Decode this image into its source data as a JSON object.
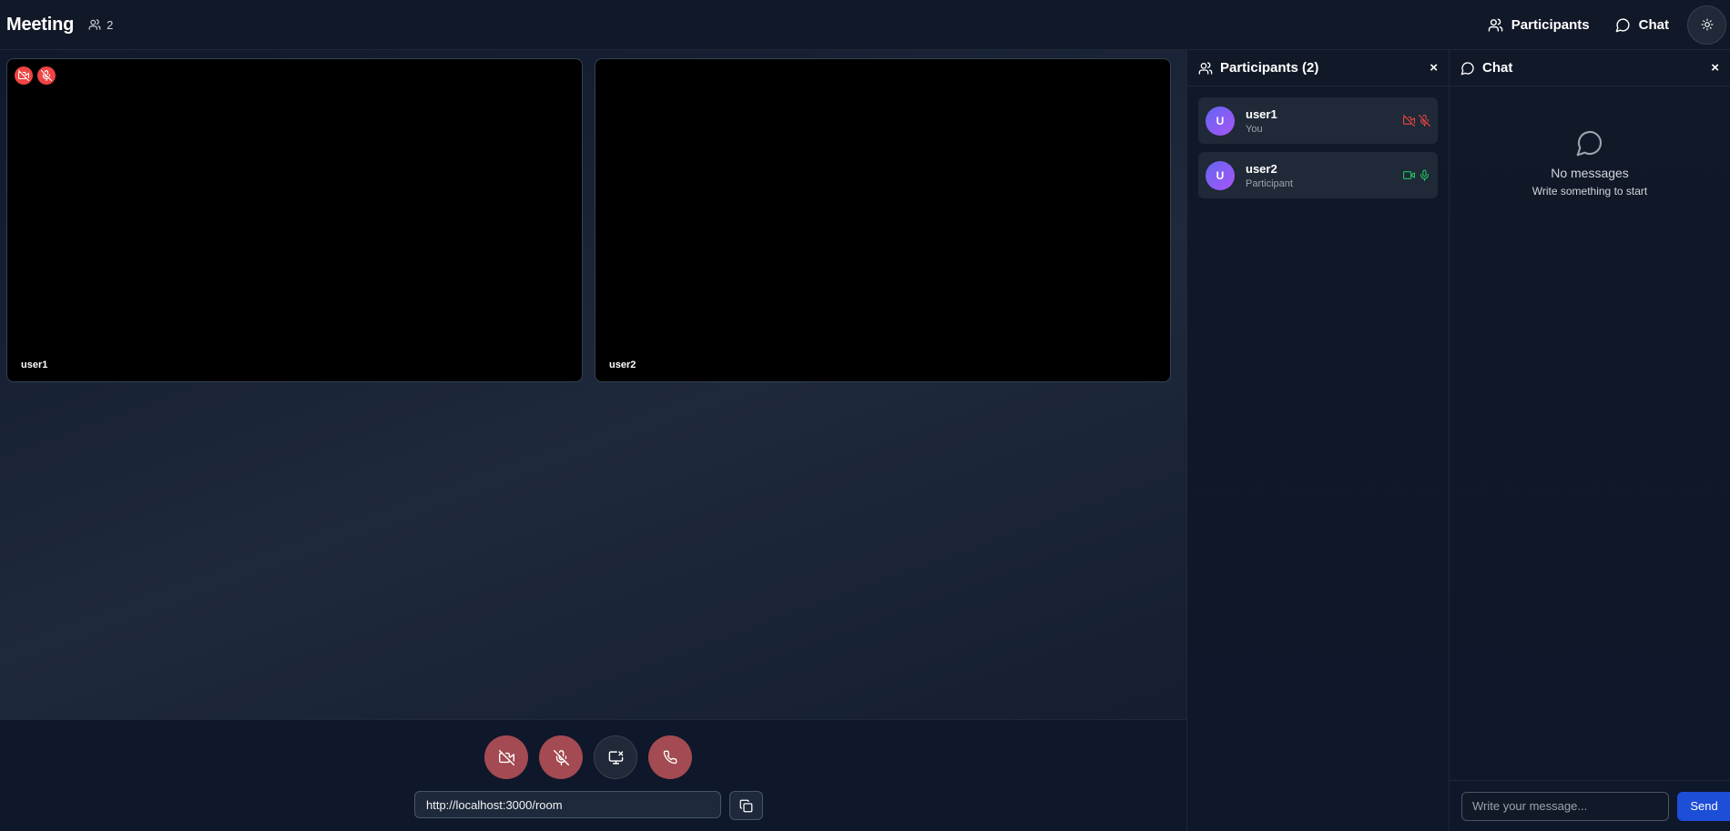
{
  "header": {
    "title": "Meeting",
    "participant_count": "2",
    "participants_button": "Participants",
    "chat_button": "Chat"
  },
  "videos": [
    {
      "name": "user1",
      "camera_off": true,
      "mic_off": true
    },
    {
      "name": "user2",
      "camera_off": false,
      "mic_off": false
    }
  ],
  "controls": {
    "meeting_link": "http://localhost:3000/room"
  },
  "participants_panel": {
    "title": "Participants (2)",
    "close": "×",
    "items": [
      {
        "name": "user1",
        "role": "You",
        "avatar": "U",
        "video": "off",
        "audio": "off"
      },
      {
        "name": "user2",
        "role": "Participant",
        "avatar": "U",
        "video": "on",
        "audio": "on"
      }
    ]
  },
  "chat_panel": {
    "title": "Chat",
    "close": "×",
    "empty_title": "No messages",
    "empty_subtitle": "Write something to start",
    "input_placeholder": "Write your message...",
    "send_label": "Send"
  },
  "colors": {
    "danger": "#ef4444",
    "danger_button": "#a34a52",
    "success": "#22c55e",
    "primary": "#1d4ed8",
    "avatar_gradient": "#6366f1"
  }
}
